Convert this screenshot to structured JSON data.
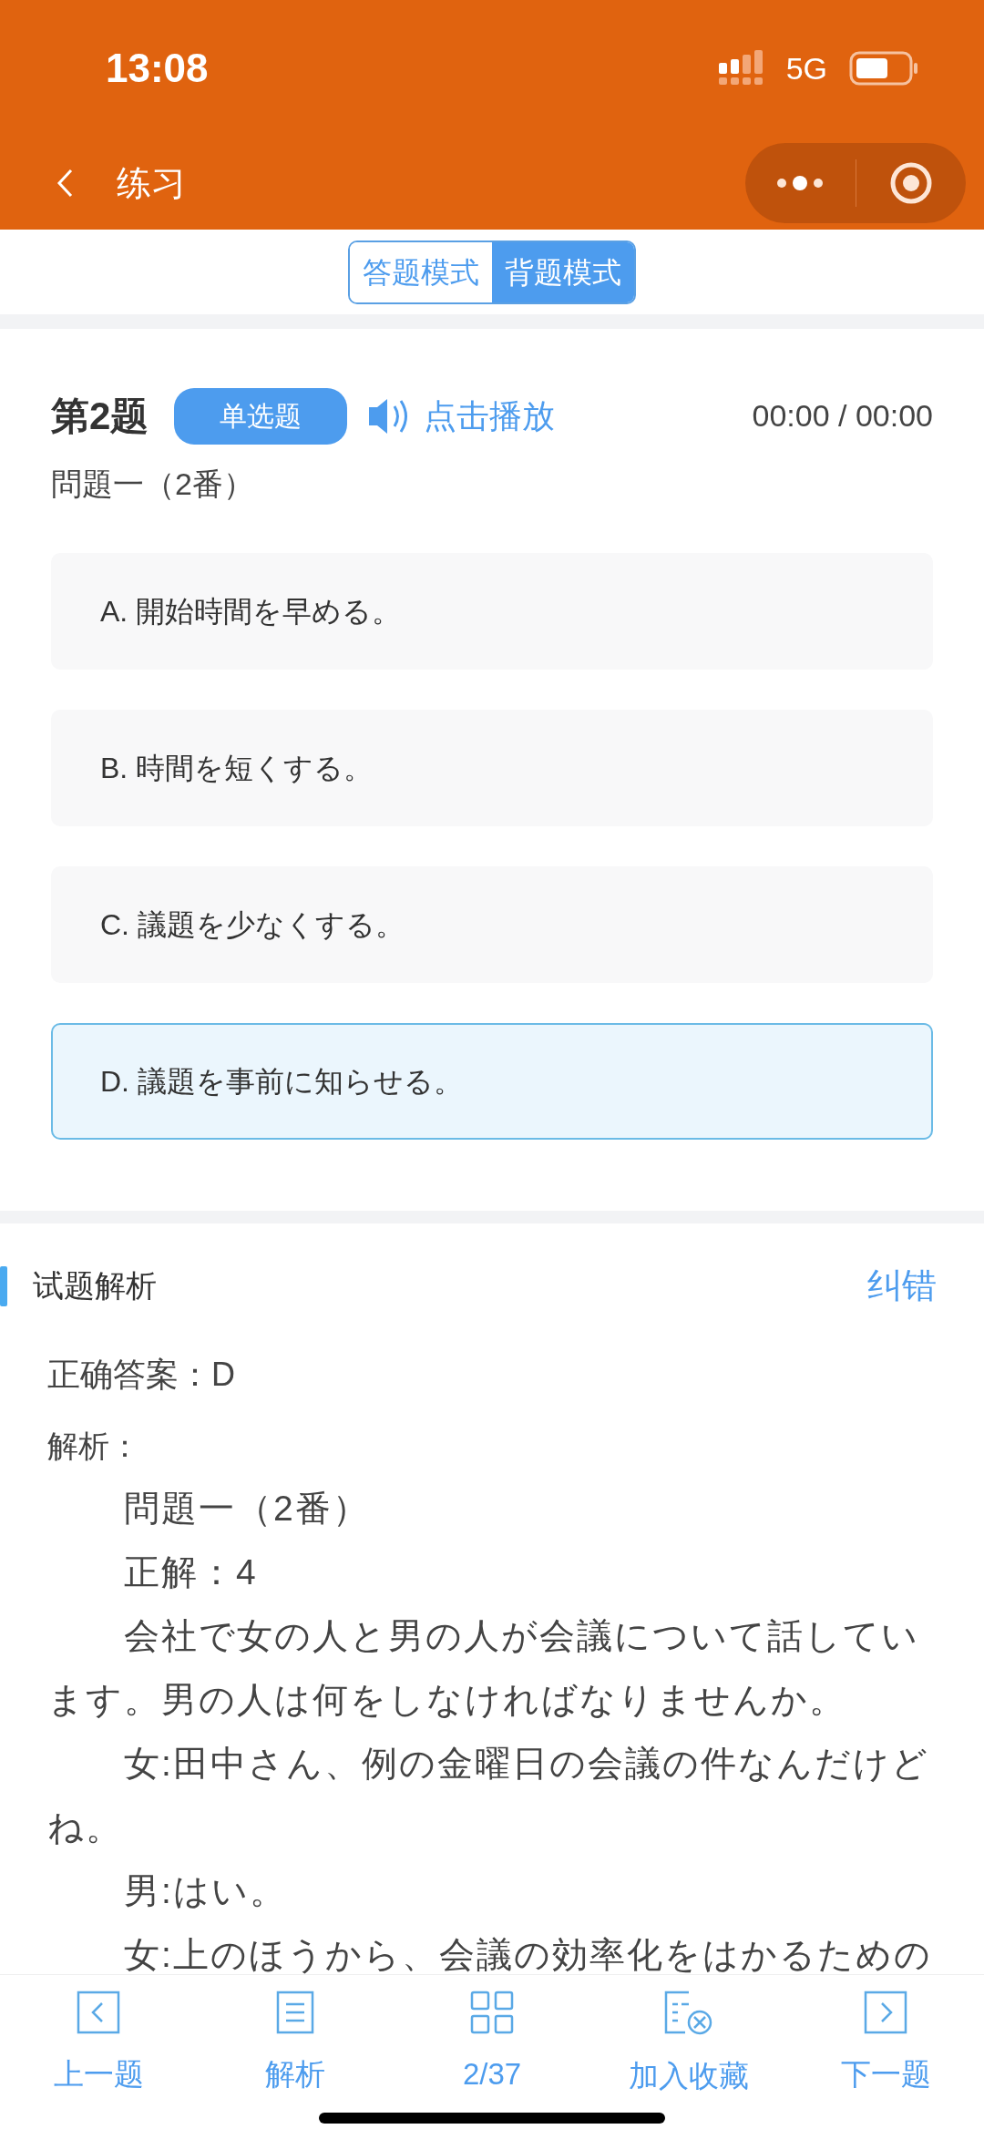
{
  "status_bar": {
    "time": "13:08",
    "network": "5G"
  },
  "nav": {
    "title": "练习"
  },
  "mode_tabs": [
    {
      "label": "答题模式",
      "selected": false
    },
    {
      "label": "背题模式",
      "selected": true
    }
  ],
  "question": {
    "number": "第2题",
    "type": "单选题",
    "play": "点击播放",
    "time": "00:00 / 00:00",
    "subtitle": "問題一（2番）",
    "options": [
      {
        "label": "A. 開始時間を早める。",
        "selected": false
      },
      {
        "label": "B. 時間を短くする。",
        "selected": false
      },
      {
        "label": "C. 議題を少なくする。",
        "selected": false
      },
      {
        "label": "D. 議題を事前に知らせる。",
        "selected": true
      }
    ]
  },
  "analysis": {
    "title": "试题解析",
    "report": "纠错",
    "answer": "正确答案：D",
    "label": "解析：",
    "paragraphs": [
      "問題一（2番）",
      "正解：4",
      "会社で女の人と男の人が会議について話しています。男の人は何をしなければなりませんか。",
      "女:田中さん、例の金曜日の会議の件なんだけどね。",
      "男:はい。",
      "女:上のほうから、会議の効率化をはかるための"
    ]
  },
  "bottom_nav": [
    {
      "kind": "prev",
      "label": "上一题"
    },
    {
      "kind": "analysis",
      "label": "解析"
    },
    {
      "kind": "grid",
      "label": "2/37"
    },
    {
      "kind": "favorite",
      "label": "加入收藏"
    },
    {
      "kind": "next",
      "label": "下一题"
    }
  ]
}
